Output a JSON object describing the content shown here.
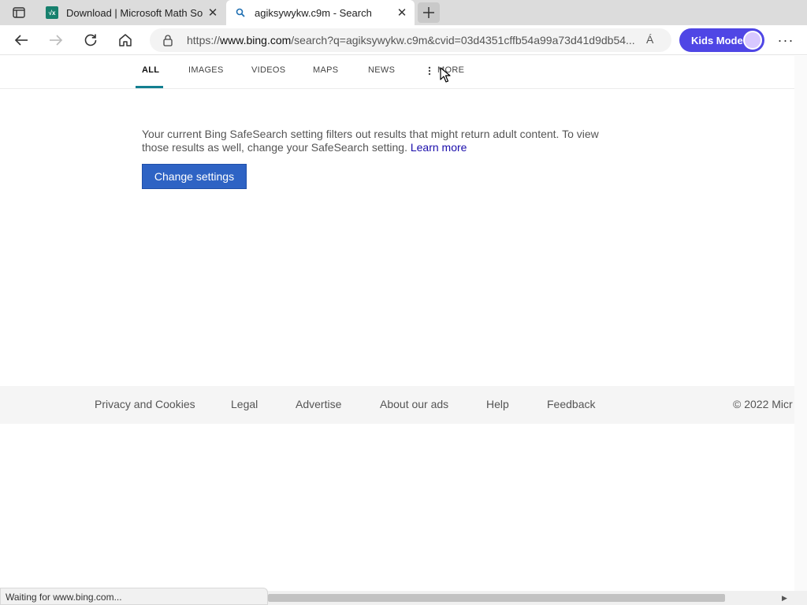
{
  "browser": {
    "tabs": [
      {
        "title": "Download | Microsoft Math Solv",
        "favicon": "math-solver-icon",
        "active": false
      },
      {
        "title": "agiksywykw.c9m - Search",
        "favicon": "search-icon",
        "active": true
      }
    ],
    "address": {
      "url_prefix": "https://",
      "url_domain": "www.bing.com",
      "url_rest": "/search?q=agiksywykw.c9m&cvid=03d4351cffb54a99a73d41d9db54...",
      "read_aloud": "Á"
    },
    "kids_mode_label": "Kids Mode"
  },
  "bing_nav": {
    "items": [
      "ALL",
      "IMAGES",
      "VIDEOS",
      "MAPS",
      "NEWS",
      "MORE"
    ]
  },
  "safesearch": {
    "message": "Your current Bing SafeSearch setting filters out results that might return adult content. To view those results as well, change your SafeSearch setting.",
    "learn_more": "Learn more",
    "button": "Change settings"
  },
  "footer": {
    "links": [
      "Privacy and Cookies",
      "Legal",
      "Advertise",
      "About our ads",
      "Help",
      "Feedback"
    ],
    "copyright": "© 2022 Micr"
  },
  "status_bar": "Waiting for www.bing.com...",
  "colors": {
    "accent_underline": "#137f90",
    "button_blue": "#2e63c4",
    "kids_mode": "#4f46e5",
    "link": "#1a0dab"
  }
}
